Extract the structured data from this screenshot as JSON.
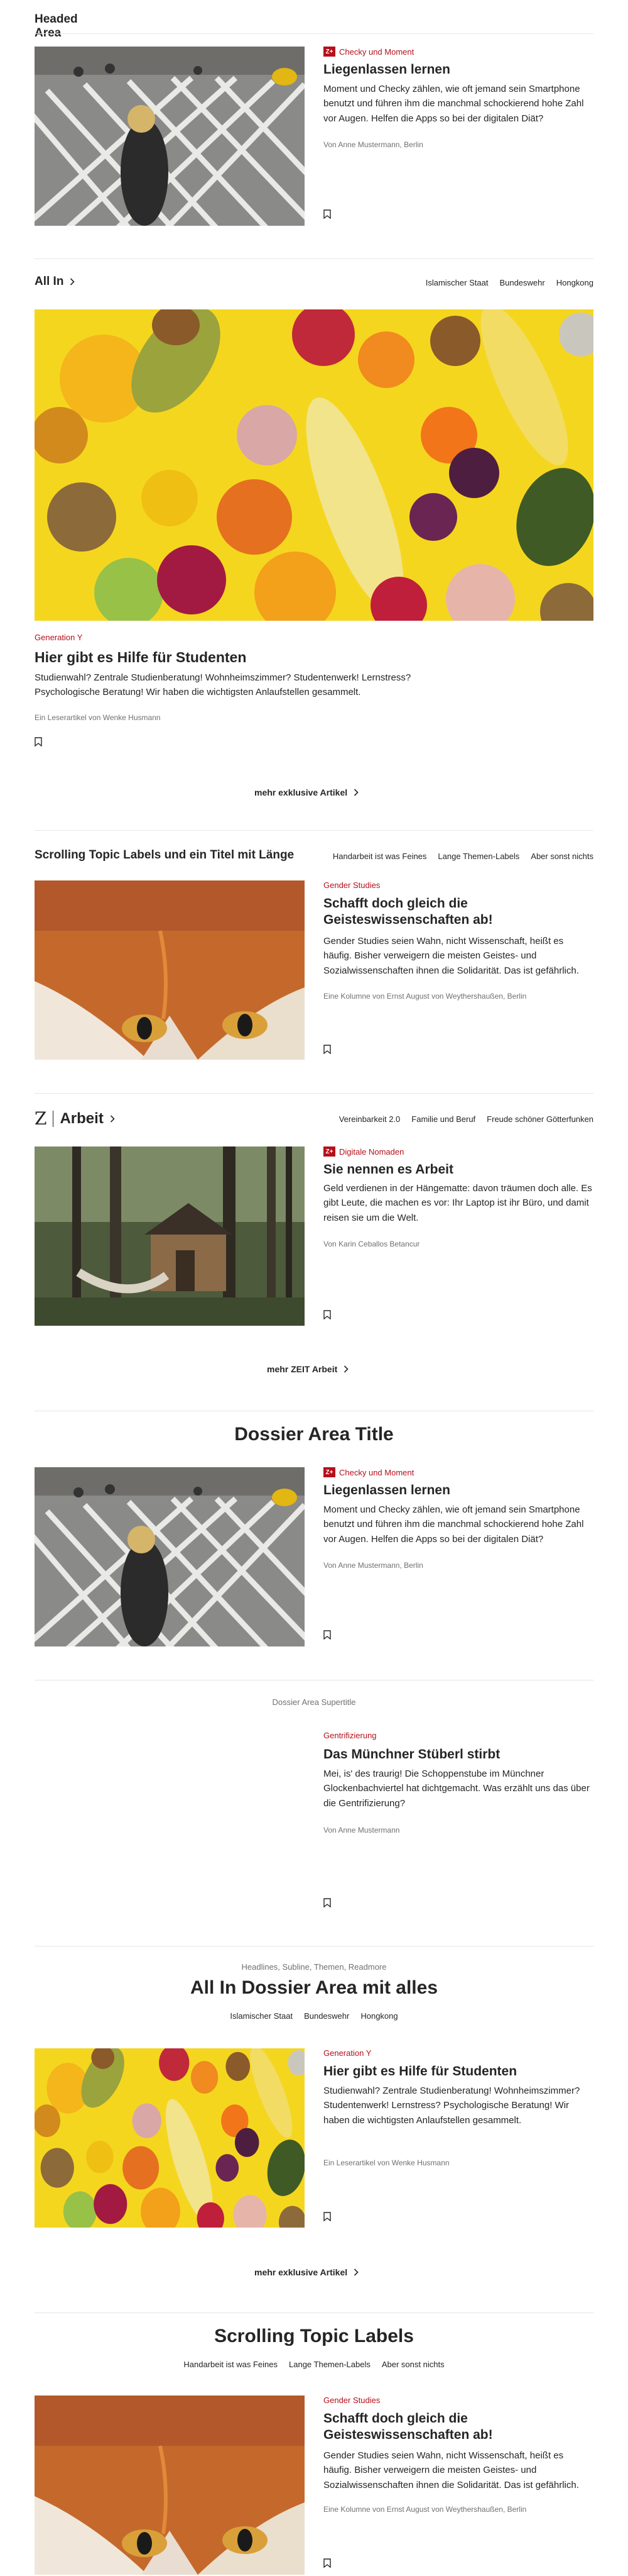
{
  "headed_area": {
    "section_title": "Headed Area",
    "teaser": {
      "kicker": "Checky und Moment",
      "title": "Liegenlassen lernen",
      "text": "Moment und Checky zählen, wie oft jemand sein Smartphone benutzt und führen ihm die manchmal schockierend hohe Zahl vor Augen. Helfen die Apps so bei der digitalen Diät?",
      "byline": "Von Anne Mustermann, Berlin"
    }
  },
  "all_in": {
    "section_title": "All In",
    "topics": [
      "Islamischer Staat",
      "Bundeswehr",
      "Hongkong"
    ],
    "teaser": {
      "kicker": "Generation Y",
      "title": "Hier gibt es Hilfe für Studenten",
      "text": "Studienwahl? Zentrale Studienberatung! Wohnheimszimmer? Studentenwerk! Lernstress? Psychologische Beratung! Wir haben die wichtigsten Anlaufstellen gesammelt.",
      "byline": "Ein Leserartikel von Wenke Husmann"
    },
    "more_label": "mehr exklusive Artikel"
  },
  "scrolling_topics": {
    "section_title": "Scrolling Topic Labels und ein Titel mit Länge",
    "topics": [
      "Handarbeit ist was Feines",
      "Lange Themen-Labels",
      "Aber sonst nichts"
    ],
    "teaser": {
      "kicker": "Gender Studies",
      "title": "Schafft doch gleich die Geisteswissenschaften ab!",
      "text": "Gender Studies seien Wahn, nicht Wissenschaft, heißt es häufig. Bisher verweigern die meisten Geistes- und Sozialwissenschaften ihnen die Solidarität. Das ist gefährlich.",
      "byline": "Eine Kolumne von Ernst August von Weythershaußen, Berlin"
    }
  },
  "arbeit": {
    "logo": "Z",
    "section_title": "Arbeit",
    "topics": [
      "Vereinbarkeit 2.0",
      "Familie und Beruf",
      "Freude schöner Götterfunken"
    ],
    "teaser": {
      "kicker": "Digitale Nomaden",
      "title": "Sie nennen es Arbeit",
      "text": "Geld verdienen in der Hängematte: davon träumen doch alle. Es gibt Leute, die machen es vor: Ihr Laptop ist ihr Büro, und damit reisen sie um die Welt.",
      "byline": "Von Karin Ceballos Betancur"
    },
    "more_label": "mehr ZEIT Arbeit"
  },
  "dossier": {
    "section_title": "Dossier Area Title",
    "teaser": {
      "kicker": "Checky und Moment",
      "title": "Liegenlassen lernen",
      "text": "Moment und Checky zählen, wie oft jemand sein Smartphone benutzt und führen ihm die manchmal schockierend hohe Zahl vor Augen. Helfen die Apps so bei der digitalen Diät?",
      "byline": "Von Anne Mustermann, Berlin"
    }
  },
  "dossier_supertitle": {
    "supertitle": "Dossier Area Supertitle",
    "teaser": {
      "kicker": "Gentrifizierung",
      "title": "Das Münchner Stüberl stirbt",
      "text": "Mei, is' des traurig! Die Schoppenstube im Münchner Glockenbachviertel hat dichtgemacht. Was erzählt uns das über die Gentrifizierung?",
      "byline": "Von Anne Mustermann"
    }
  },
  "all_in_dossier": {
    "supertitle": "Headlines, Subline, Themen, Readmore",
    "section_title": "All In Dossier Area mit alles",
    "topics": [
      "Islamischer Staat",
      "Bundeswehr",
      "Hongkong"
    ],
    "teaser": {
      "kicker": "Generation Y",
      "title": "Hier gibt es Hilfe für Studenten",
      "text": "Studienwahl? Zentrale Studienberatung! Wohnheimszimmer? Studentenwerk! Lernstress? Psychologische Beratung! Wir haben die wichtigsten Anlaufstellen gesammelt.",
      "byline": "Ein Leserartikel von Wenke Husmann"
    },
    "more_label": "mehr exklusive Artikel"
  },
  "scrolling_topics_2": {
    "section_title": "Scrolling Topic Labels",
    "topics": [
      "Handarbeit ist was Feines",
      "Lange Themen-Labels",
      "Aber sonst nichts"
    ],
    "teaser": {
      "kicker": "Gender Studies",
      "title": "Schafft doch gleich die Geisteswissenschaften ab!",
      "text": "Gender Studies seien Wahn, nicht Wissenschaft, heißt es häufig. Bisher verweigern die meisten Geistes- und Sozialwissenschaften ihnen die Solidarität. Das ist gefährlich.",
      "byline": "Eine Kolumne von Ernst August von Weythershaußen, Berlin"
    }
  },
  "colors": {
    "accent": "#b4101b",
    "text": "#252525",
    "muted": "#707070",
    "rule": "#e6e6e6",
    "fruit_bg": "#f5d61f"
  }
}
